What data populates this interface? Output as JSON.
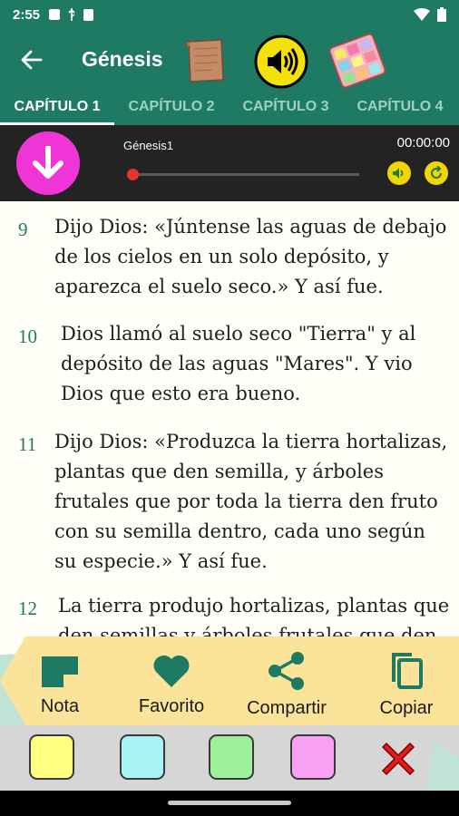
{
  "status_bar": {
    "time": "2:55"
  },
  "app_bar": {
    "title": "Génesis"
  },
  "tabs": [
    {
      "label": "CAPÍTULO 1"
    },
    {
      "label": "CAPÍTULO 2"
    },
    {
      "label": "CAPÍTULO 3"
    },
    {
      "label": "CAPÍTULO 4"
    }
  ],
  "player": {
    "track": "Génesis1",
    "time": "00:00:00",
    "progress": 0
  },
  "verses": [
    {
      "num": "9",
      "lines": [
        "Dijo Dios: «Júntense las aguas de debajo",
        "de los cielos en un solo depósito, y",
        "aparezca el suelo seco.» Y así fue."
      ]
    },
    {
      "num": "10",
      "lines": [
        "Dios llamó al suelo seco \"Tierra\" y al",
        "depósito de las aguas \"Mares\". Y vio",
        "Dios que esto era bueno."
      ]
    },
    {
      "num": "11",
      "lines": [
        "Dijo Dios: «Produzca la tierra hortalizas,",
        "plantas que den semilla, y árboles",
        "frutales que por toda la tierra den fruto",
        "con su semilla dentro, cada uno según",
        "su especie.» Y así fue."
      ]
    },
    {
      "num": "12",
      "lines": [
        "La tierra produjo hortalizas, plantas que",
        "den semillas y árboles frutales que den"
      ]
    }
  ],
  "actions": {
    "note": "Nota",
    "favorite": "Favorito",
    "share": "Compartir",
    "copy": "Copiar"
  },
  "colors": {
    "accent": "#1e7a63",
    "swatches": [
      "#ffff80",
      "#a8f4f4",
      "#9ef09a",
      "#f7a0f4"
    ]
  }
}
